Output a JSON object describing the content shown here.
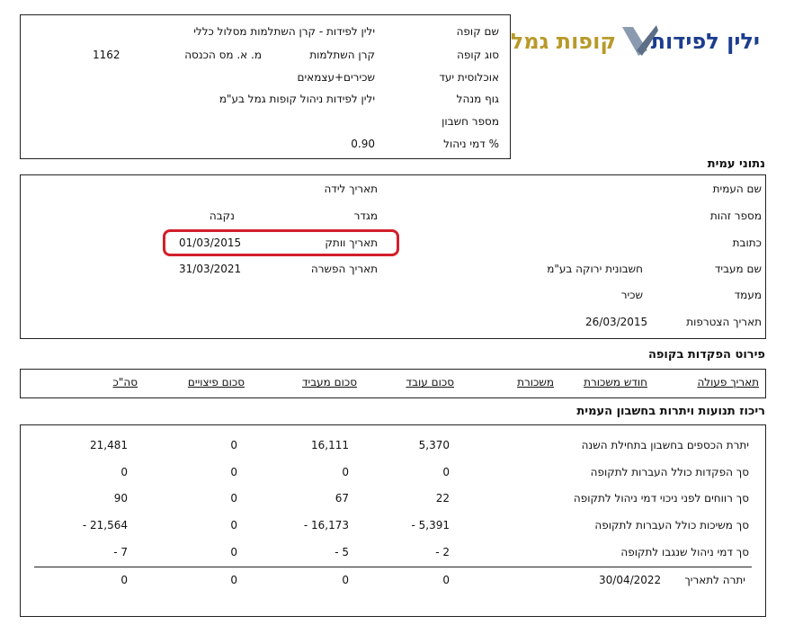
{
  "logo": {
    "brand": "ילין לפידות",
    "sub": "קופות גמל",
    "brand_color": "#1c3d8f",
    "sub_color": "#b89a2a"
  },
  "fund": {
    "labels": [
      "שם קופה",
      "סוג קופה",
      "אוכלוסית יעד",
      "גוף מנהל",
      "מספר חשבון",
      "% דמי ניהול"
    ],
    "values": [
      "ילין לפידות - קרן השתלמות מסלול כללי",
      "קרן השתלמות",
      "שכירים+עצמאים",
      "ילין לפידות ניהול קופות גמל בע\"מ",
      "",
      "0.90"
    ],
    "tax_label": "מ. א. מס הכנסה",
    "tax_value": "1162"
  },
  "member": {
    "section_title": "נתוני עמית",
    "labels": [
      "שם העמית",
      "מספר זהות",
      "כתובת",
      "שם מעביד",
      "מעמד",
      "תאריך הצטרפות"
    ],
    "employer": "חשבונית ירוקה בע\"מ",
    "status": "שכיר",
    "join_date": "26/03/2015",
    "mid_labels": [
      "תאריך לידה",
      "מגדר",
      "תאריך וותק",
      "תאריך הפשרה"
    ],
    "mid_values": [
      "",
      "נקבה",
      "01/03/2015",
      "31/03/2021"
    ],
    "highlight_color": "#d21f2b"
  },
  "deposits": {
    "section_title": "פירוט הפקדות בקופה",
    "headers": [
      "תאריך פעולה",
      "חודש משכורת",
      "משכורת",
      "סכום עובד",
      "סכום מעביד",
      "סכום פיצויים",
      "סה\"כ"
    ]
  },
  "summary": {
    "section_title": "ריכוז תנועות ויתרות בחשבון העמית",
    "rows": [
      {
        "label": "יתרת הכספים בחשבון בתחילת השנה",
        "employee": "5,370",
        "employer": "16,111",
        "severance": "0",
        "total": "21,481"
      },
      {
        "label": "סך הפקדות כולל העברות לתקופה",
        "employee": "0",
        "employer": "0",
        "severance": "0",
        "total": "0"
      },
      {
        "label": "סך רווחים לפני ניכוי דמי ניהול לתקופה",
        "employee": "22",
        "employer": "67",
        "severance": "0",
        "total": "90"
      },
      {
        "label": "סך משיכות כולל העברות לתקופה",
        "employee": "5,391 -",
        "employer": "16,173 -",
        "severance": "0",
        "total": "21,564 -"
      },
      {
        "label": "סך דמי ניהול שנגבו לתקופה",
        "employee": "2 -",
        "employer": "5 -",
        "severance": "0",
        "total": "7 -"
      }
    ],
    "balance": {
      "label": "יתרה לתאריך",
      "date": "30/04/2022",
      "employee": "0",
      "employer": "0",
      "severance": "0",
      "total": "0"
    }
  }
}
